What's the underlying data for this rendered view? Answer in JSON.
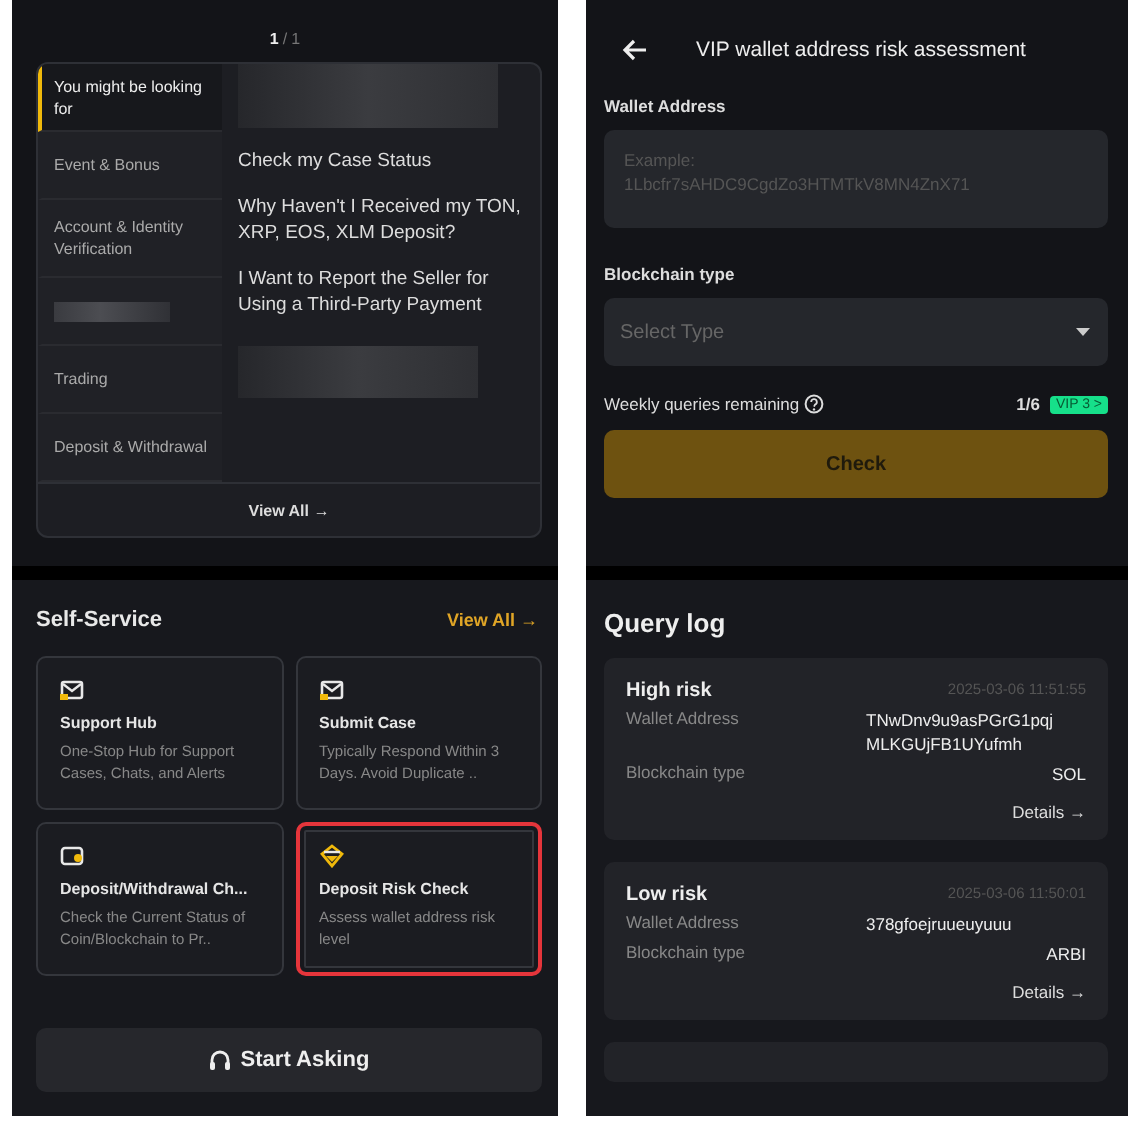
{
  "help_screen": {
    "pager": {
      "current": "1",
      "separator": "/",
      "total": "1"
    },
    "categories": [
      {
        "kind": "text",
        "label": "You might be looking for",
        "selected": true
      },
      {
        "kind": "text",
        "label": "Event & Bonus",
        "selected": false
      },
      {
        "kind": "text",
        "label": "Account & Identity Verification",
        "selected": false
      },
      {
        "kind": "redacted",
        "selected": false
      },
      {
        "kind": "text",
        "label": "Trading",
        "selected": false
      },
      {
        "kind": "text",
        "label": "Deposit & Withdrawal",
        "selected": false
      }
    ],
    "questions": [
      {
        "kind": "redacted"
      },
      {
        "kind": "text",
        "label": "Check my Case Status"
      },
      {
        "kind": "text",
        "label": "Why Haven't I Received my TON, XRP, EOS, XLM Deposit?"
      },
      {
        "kind": "text",
        "label": "I Want to Report the Seller for Using a Third-Party Payment"
      },
      {
        "kind": "redacted"
      }
    ],
    "view_all": "View All →",
    "self_service": {
      "title": "Self-Service",
      "view_all": "View All →",
      "cards": [
        {
          "kind": "mail",
          "title": "Support Hub",
          "description": "One-Stop Hub for Support Cases, Chats, and Alerts",
          "highlighted": false
        },
        {
          "kind": "mail",
          "title": "Submit Case",
          "description": "Typically Respond Within 3 Days. Avoid Duplicate ..",
          "highlighted": false
        },
        {
          "kind": "wallet",
          "title": "Deposit/Withdrawal Ch...",
          "description": "Check the Current Status of Coin/Blockchain to Pr..",
          "highlighted": false
        },
        {
          "kind": "shield",
          "title": "Deposit Risk Check",
          "description": "Assess wallet address risk level",
          "highlighted": true
        }
      ]
    },
    "start_button": "Start Asking"
  },
  "risk_screen": {
    "title": "VIP wallet address risk assessment",
    "wallet_label": "Wallet Address",
    "wallet_placeholder": "Example:\n1Lbcfr7sAHDC9CgdZo3HTMTkV8MN4ZnX71",
    "chain_label": "Blockchain type",
    "chain_placeholder": "Select Type",
    "quota_label": "Weekly queries remaining",
    "quota_value": "1/6",
    "vip_badge": "VIP 3 >",
    "check_button": "Check",
    "disabled": true,
    "log_title": "Query log",
    "entries": [
      {
        "risk": "High risk",
        "time": "2025-03-06 11:51:55",
        "fields": [
          {
            "label": "Wallet Address",
            "value": "TNwDnv9u9asPGrG1pqj MLKGUjFB1UYufmh"
          },
          {
            "label": "Blockchain type",
            "value": "SOL"
          }
        ],
        "details": "Details →"
      },
      {
        "risk": "Low risk",
        "time": "2025-03-06 11:50:01",
        "fields": [
          {
            "label": "Wallet Address",
            "value": "378gfoejruueuyuuu"
          },
          {
            "label": "Blockchain type",
            "value": "ARBI"
          }
        ],
        "details": "Details →"
      }
    ]
  }
}
